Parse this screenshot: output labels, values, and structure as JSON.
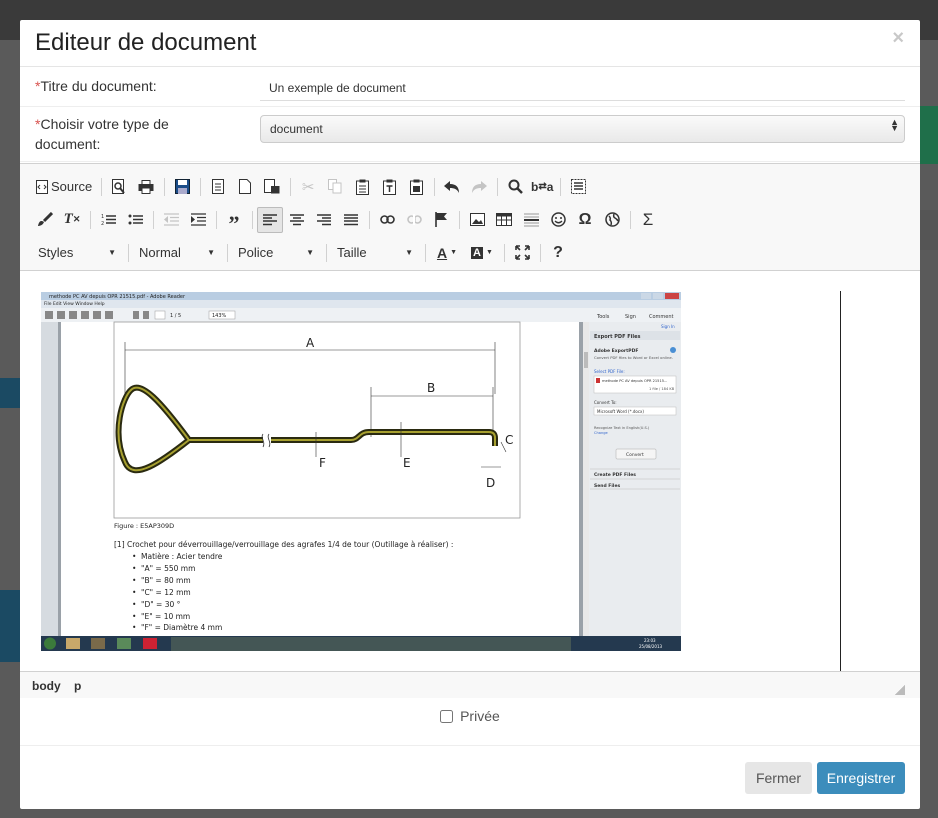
{
  "modal": {
    "title": "Editeur de document",
    "close_symbol": "×"
  },
  "form": {
    "required_mark": "*",
    "title_label": "Titre du document:",
    "title_value": "Un exemple de document",
    "type_label": "Choisir votre type de document:",
    "type_value": "document",
    "type_arrow": "▲▼"
  },
  "toolbar": {
    "source_label": "Source",
    "styles_label": "Styles",
    "format_label": "Normal",
    "font_label": "Police",
    "size_label": "Taille",
    "help_label": "?",
    "icons_row1": [
      "source-icon",
      "preview-icon",
      "print-icon",
      "save-icon",
      "templates-icon",
      "new-page-icon",
      "paste-from-word-icon",
      "cut-icon",
      "copy-icon",
      "paste-icon",
      "paste-text-icon",
      "paste-word-icon",
      "undo-icon",
      "redo-icon",
      "find-icon",
      "replace-icon",
      "select-all-icon"
    ],
    "icons_row2": [
      "remove-format-brush-icon",
      "clear-format-icon",
      "numbered-list-icon",
      "bulleted-list-icon",
      "outdent-icon",
      "indent-icon",
      "blockquote-icon",
      "align-left-icon",
      "align-center-icon",
      "align-right-icon",
      "justify-icon",
      "link-icon",
      "unlink-icon",
      "anchor-icon",
      "image-icon",
      "table-icon",
      "horizontal-line-icon",
      "smiley-icon",
      "special-char-icon",
      "iframe-icon",
      "sum-icon"
    ]
  },
  "embedded_image": {
    "window_title": "methode PC AV depuis OPR 21515.pdf - Adobe Reader",
    "menu": "File  Edit  View  Window  Help",
    "zoom": "143%",
    "page": "1 / 5",
    "tabs": [
      "Tools",
      "Sign",
      "Comment"
    ],
    "sign_in": "Sign In",
    "panel_title": "Export PDF Files",
    "panel_sub": "Adobe ExportPDF",
    "panel_desc": "Convert PDF files to Word or Excel online.",
    "select_file": "Select PDF File:",
    "file_name": "methode PC AV depuis OPR 21515...",
    "file_count": "1 file / 184 KB",
    "convert_to": "Convert To:",
    "convert_value": "Microsoft Word (*.docx)",
    "recognize": "Recognize Text in English(U.S.)",
    "change": "Change",
    "convert_btn": "Convert",
    "create_pdf": "Create PDF Files",
    "send_files": "Send Files",
    "labels": [
      "A",
      "B",
      "C",
      "D",
      "E",
      "F"
    ],
    "figure": "Figure : E5AP309D",
    "heading": "[1] Crochet pour déverrouillage/verrouillage des agrafes 1/4 de tour (Outillage à réaliser) :",
    "bullets": [
      "Matière : Acier tendre",
      "\"A\" = 550 mm",
      "\"B\" = 80 mm",
      "\"C\" = 12 mm",
      "\"D\" = 30 °",
      "\"E\" = 10 mm",
      "\"F\" = Diamètre 4 mm"
    ],
    "clock": "23:03",
    "date": "25/08/2013"
  },
  "path_bar": [
    "body",
    "p"
  ],
  "private_label": "Privée",
  "footer": {
    "close_label": "Fermer",
    "save_label": "Enregistrer"
  }
}
